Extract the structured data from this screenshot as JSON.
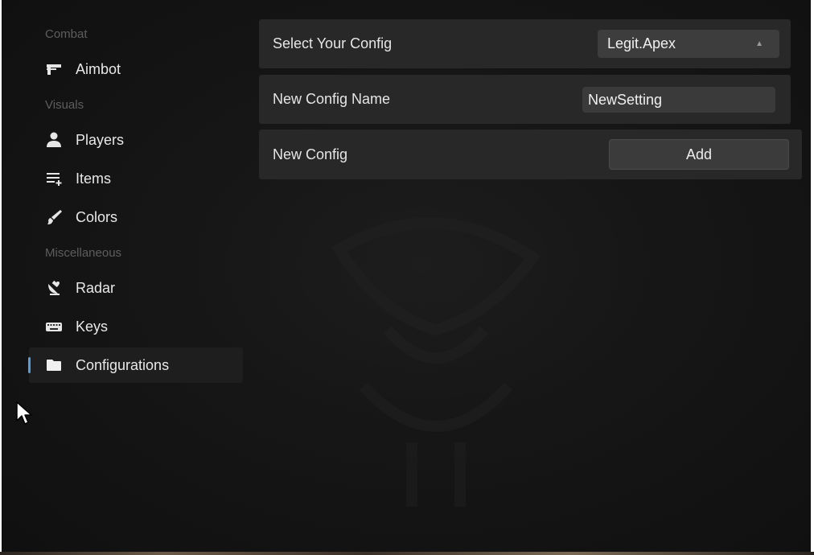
{
  "sidebar": {
    "sections": {
      "combat": "Combat",
      "visuals": "Visuals",
      "misc": "Miscellaneous"
    },
    "items": {
      "aimbot": "Aimbot",
      "players": "Players",
      "items": "Items",
      "colors": "Colors",
      "radar": "Radar",
      "keys": "Keys",
      "configurations": "Configurations"
    },
    "active": "Configurations"
  },
  "main": {
    "select_config": {
      "label": "Select Your Config",
      "value": "Legit.Apex"
    },
    "new_config_name": {
      "label": "New Config Name",
      "value": "NewSetting"
    },
    "new_config": {
      "label": "New Config",
      "button_label": "Add"
    }
  },
  "icons": {
    "aimbot": "gun-icon",
    "players": "person-icon",
    "items": "list-add-icon",
    "colors": "brush-icon",
    "radar": "satellite-icon",
    "keys": "keyboard-icon",
    "configurations": "folder-icon",
    "dropdown": "chevron-up-icon"
  },
  "colors": {
    "accent": "#5a9bd5",
    "background": "#151515",
    "panel": "#282828",
    "control": "#3d3d3d"
  }
}
